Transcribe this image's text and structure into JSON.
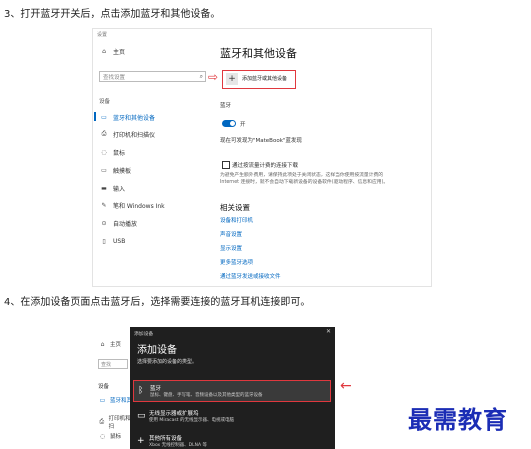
{
  "steps": {
    "step3": "3、打开蓝牙开关后，点击添加蓝牙和其他设备。",
    "step4": "4、在添加设备页面点击蓝牙后，选择需要连接的蓝牙耳机连接即可。"
  },
  "settings": {
    "window_title": "设置",
    "home": "主页",
    "search_placeholder": "查找设置",
    "section": "设备",
    "nav": [
      {
        "label": "蓝牙和其他设备",
        "icon": "bluetooth-devices-icon"
      },
      {
        "label": "打印机和扫描仪",
        "icon": "printer-icon"
      },
      {
        "label": "鼠标",
        "icon": "mouse-icon"
      },
      {
        "label": "触摸板",
        "icon": "touchpad-icon"
      },
      {
        "label": "输入",
        "icon": "keyboard-icon"
      },
      {
        "label": "笔和 Windows Ink",
        "icon": "pen-icon"
      },
      {
        "label": "自动播放",
        "icon": "autoplay-icon"
      },
      {
        "label": "USB",
        "icon": "usb-icon"
      }
    ],
    "page_title": "蓝牙和其他设备",
    "add_device": "添加蓝牙或其他设备",
    "bluetooth_label": "蓝牙",
    "toggle_state": "开",
    "discoverable": "现在可发现为\"MateBook\"蓝发现",
    "metered_download": "通过按流量计费的连接下载",
    "metered_desc": "为避免产生额外费用，请保持此项处于关闭状态，这样当你使用按流量计费的 Internet 连接时，就不会自动下载新设备的设备软件(驱动程序、信息和应用)。",
    "related": "相关设置",
    "links": [
      "设备和打印机",
      "声音设置",
      "显示设置",
      "更多蓝牙选项",
      "通过蓝牙发送或接收文件"
    ]
  },
  "dialog": {
    "bg_home": "主页",
    "bg_search": "查找",
    "bg_section": "设备",
    "bg_nav": [
      "蓝牙和其",
      "打印机和扫",
      "鼠标"
    ],
    "title": "添加设备",
    "heading": "添加设备",
    "subtitle": "选择要添加的设备的类型。",
    "options": [
      {
        "title": "蓝牙",
        "desc": "鼠标、键盘、手写笔、音频设备以及其他类型的蓝牙设备",
        "icon": "bluetooth-icon"
      },
      {
        "title": "无线显示器或扩展坞",
        "desc": "使用 Miracast 的无线显示器、电视或电脑",
        "icon": "monitor-icon"
      },
      {
        "title": "其他所有设备",
        "desc": "Xbox 无线控制器、DLNA 等",
        "icon": "plus-icon"
      }
    ]
  },
  "watermark": "最需教育",
  "colors": {
    "accent": "#0067c0",
    "highlight": "#e0383e",
    "dialog_bg": "#1f1f1f",
    "watermark": "#1b2db5"
  }
}
